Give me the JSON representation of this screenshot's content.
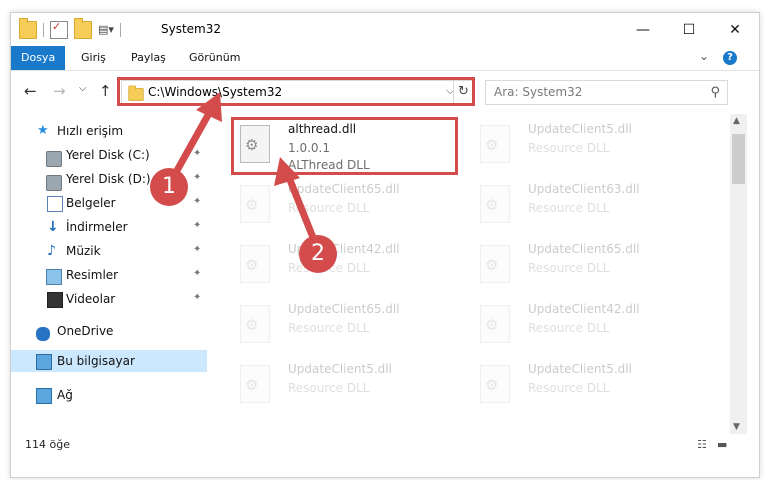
{
  "window": {
    "title": "System32",
    "controls": {
      "minimize": "—",
      "maximize": "☐",
      "close": "✕"
    }
  },
  "ribbon": {
    "tabs": [
      "Dosya",
      "Giriş",
      "Paylaş",
      "Görünüm"
    ],
    "active_tab": "Dosya",
    "expand_glyph": "⌄",
    "help_glyph": "?"
  },
  "address_bar": {
    "path": "C:\\Windows\\System32",
    "dropdown_glyph": "⌵",
    "refresh_glyph": "↻"
  },
  "search": {
    "placeholder": "Ara: System32",
    "icon": "search-icon"
  },
  "nav_glyphs": {
    "back": "←",
    "forward": "→",
    "history": "⌵",
    "up": "↑"
  },
  "sidebar": {
    "quick_access": "Hızlı erişim",
    "items": [
      {
        "label": "Yerel Disk (C:)",
        "icon": "disk-icon",
        "pinned": true
      },
      {
        "label": "Yerel Disk (D:)",
        "icon": "disk-icon",
        "pinned": true
      },
      {
        "label": "Belgeler",
        "icon": "documents-icon",
        "pinned": true
      },
      {
        "label": "İndirmeler",
        "icon": "downloads-icon",
        "pinned": true
      },
      {
        "label": "Müzik",
        "icon": "music-icon",
        "pinned": true
      },
      {
        "label": "Resimler",
        "icon": "pictures-icon",
        "pinned": true
      },
      {
        "label": "Videolar",
        "icon": "videos-icon",
        "pinned": true
      }
    ],
    "onedrive": "OneDrive",
    "this_pc": "Bu bilgisayar",
    "network": "Ağ",
    "pin_glyph": "📌"
  },
  "files": {
    "highlighted": {
      "name": "althread.dll",
      "version": "1.0.0.1",
      "description": "ALThread DLL"
    },
    "faded": [
      {
        "name": "UpdateClient5.dll",
        "description": "Resource DLL"
      },
      {
        "name": "UpdateClient65.dll",
        "description": "Resource DLL"
      },
      {
        "name": "UpdateClient63.dll",
        "description": "Resource DLL"
      },
      {
        "name": "UpdateClient42.dll",
        "description": "Resource DLL"
      },
      {
        "name": "UpdateClient65.dll",
        "description": "Resource DLL"
      },
      {
        "name": "UpdateClient65.dll",
        "description": "Resource DLL"
      },
      {
        "name": "UpdateClient42.dll",
        "description": "Resource DLL"
      },
      {
        "name": "UpdateClient5.dll",
        "description": "Resource DLL"
      },
      {
        "name": "UpdateClient5.dll",
        "description": "Resource DLL"
      }
    ]
  },
  "status_bar": {
    "item_count": "114 öğe"
  },
  "annotations": {
    "step1": "1",
    "step2": "2"
  },
  "colors": {
    "accent": "#1979ca",
    "highlight": "#d34b4b",
    "selected": "#cce8ff"
  }
}
